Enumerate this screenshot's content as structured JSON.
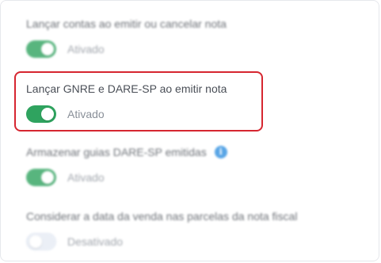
{
  "settings": [
    {
      "title": "Lançar contas ao emitir ou cancelar nota",
      "status": "Ativado",
      "enabled": true,
      "focused": false
    },
    {
      "title": "Lançar GNRE e DARE-SP ao emitir nota",
      "status": "Ativado",
      "enabled": true,
      "focused": true
    },
    {
      "title": "Armazenar guias DARE-SP emitidas",
      "status": "Ativado",
      "enabled": true,
      "focused": false,
      "info_icon": "info-icon",
      "info_glyph": "i"
    },
    {
      "title": "Considerar a data da venda nas parcelas da nota fiscal",
      "status": "Desativado",
      "enabled": false,
      "focused": false
    }
  ],
  "colors": {
    "toggle_on": "#2fa35f",
    "toggle_off": "#e7ecf5",
    "highlight_border": "#d62630",
    "info_icon": "#2f8fe0"
  }
}
